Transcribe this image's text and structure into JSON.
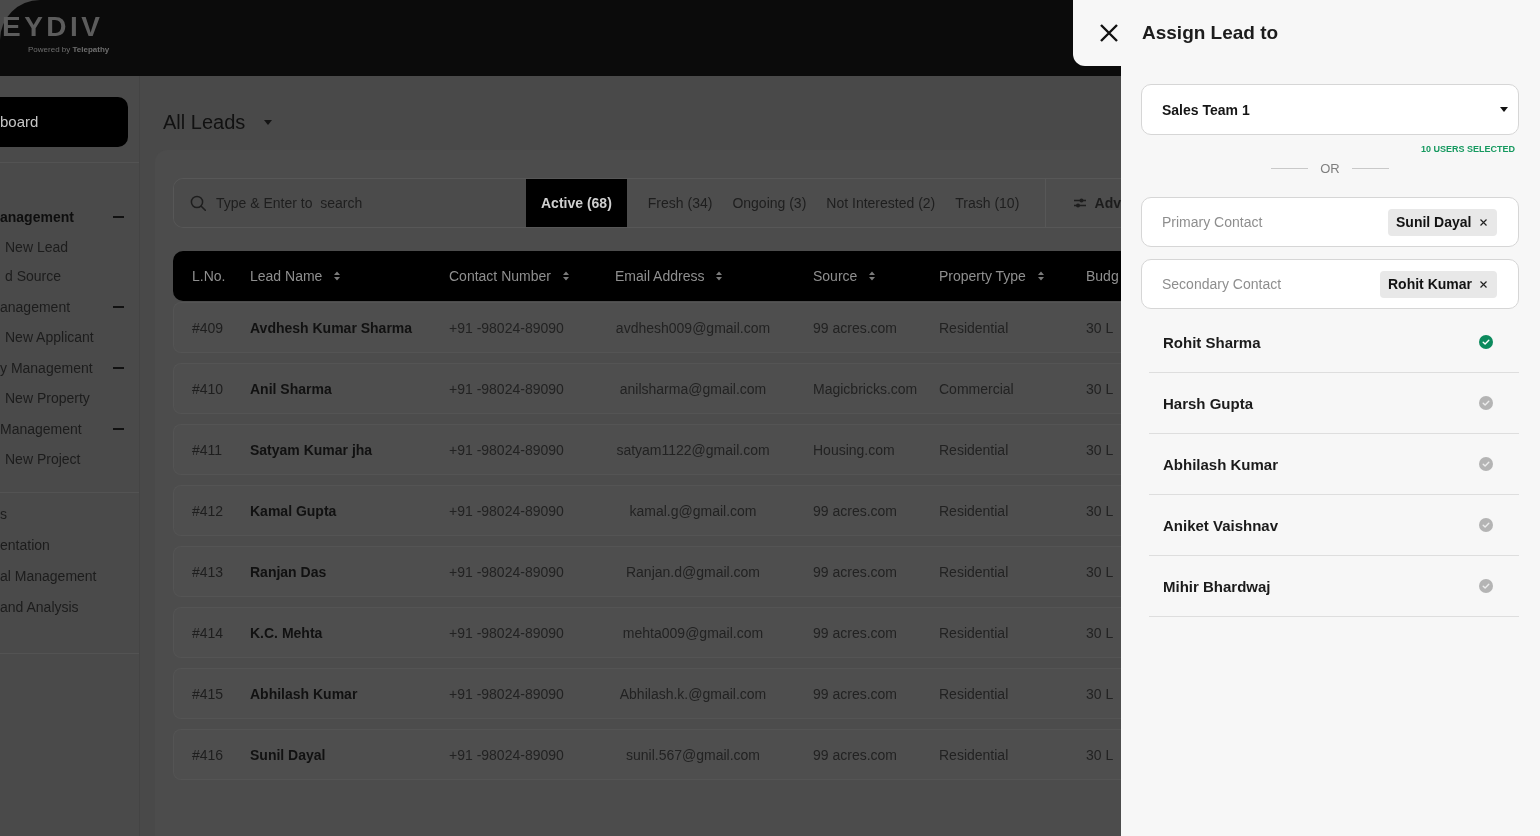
{
  "topbar": {
    "logo": "EYDIV",
    "tagline": "Powered by **Telepathy**"
  },
  "sidebar": {
    "sections": [
      {
        "items": [
          {
            "kind": "link",
            "label": "board",
            "selected": true
          }
        ]
      },
      {
        "items": [
          {
            "kind": "group",
            "label": "anagement",
            "selected": true,
            "expanded": true,
            "children": [
              {
                "label": "New Lead",
                "selected": false
              },
              {
                "label": "d Source",
                "selected": false
              }
            ]
          },
          {
            "kind": "group",
            "label": "anagement",
            "selected": false,
            "expanded": true,
            "children": [
              {
                "label": "New Applicant",
                "selected": false
              }
            ]
          },
          {
            "kind": "group",
            "label": "y Management",
            "selected": false,
            "expanded": true,
            "children": [
              {
                "label": "New Property",
                "selected": false
              }
            ]
          },
          {
            "kind": "group",
            "label": "Management",
            "selected": false,
            "expanded": true,
            "children": [
              {
                "label": "New Project",
                "selected": false
              }
            ]
          }
        ]
      },
      {
        "items": [
          {
            "kind": "link",
            "label": "s",
            "selected": false
          },
          {
            "kind": "link",
            "label": "entation",
            "selected": false
          },
          {
            "kind": "link",
            "label": "al Management",
            "selected": false
          },
          {
            "kind": "link",
            "label": "and Analysis",
            "selected": false
          }
        ]
      }
    ]
  },
  "main": {
    "title": "All Leads",
    "filter_bar": {
      "search": {
        "placeholder": "Type & Enter to  search"
      },
      "tabs": [
        {
          "label": "Active (68)",
          "selected": true
        },
        {
          "label": "Fresh (34)",
          "selected": false
        },
        {
          "label": "Ongoing (3)",
          "selected": false
        },
        {
          "label": "Not Interested (2)",
          "selected": false
        },
        {
          "label": "Trash (10)",
          "selected": false
        }
      ],
      "advanced_button": "Adv"
    },
    "table": {
      "columns": [
        {
          "label": "L.No.",
          "sortable": false
        },
        {
          "label": "Lead Name",
          "sortable": true
        },
        {
          "label": "Contact Number",
          "sortable": true
        },
        {
          "label": "Email Address",
          "sortable": true
        },
        {
          "label": "Source",
          "sortable": true
        },
        {
          "label": "Property Type",
          "sortable": true
        },
        {
          "label": "Budg",
          "sortable": false
        }
      ],
      "rows": [
        {
          "cells": [
            "#409",
            "Avdhesh Kumar Sharma",
            "+91 -98024-89090",
            "avdhesh009@gmail.com",
            "99 acres.com",
            "Residential",
            "30 L"
          ]
        },
        {
          "cells": [
            "#410",
            "Anil Sharma",
            "+91 -98024-89090",
            "anilsharma@gmail.com",
            "Magicbricks.com",
            "Commercial",
            "30 L"
          ]
        },
        {
          "cells": [
            "#411",
            "Satyam Kumar jha",
            "+91 -98024-89090",
            "satyam1122@gmail.com",
            "Housing.com",
            "Residential",
            "30 L"
          ]
        },
        {
          "cells": [
            "#412",
            "Kamal Gupta",
            "+91 -98024-89090",
            "kamal.g@gmail.com",
            "99 acres.com",
            "Residential",
            "30 L"
          ]
        },
        {
          "cells": [
            "#413",
            "Ranjan Das",
            "+91 -98024-89090",
            "Ranjan.d@gmail.com",
            "99 acres.com",
            "Residential",
            "30 L"
          ]
        },
        {
          "cells": [
            "#414",
            "K.C. Mehta",
            "+91 -98024-89090",
            "mehta009@gmail.com",
            "99 acres.com",
            "Residential",
            "30 L"
          ]
        },
        {
          "cells": [
            "#415",
            "Abhilash Kumar",
            "+91 -98024-89090",
            "Abhilash.k.@gmail.com",
            "99 acres.com",
            "Residential",
            "30 L"
          ]
        },
        {
          "cells": [
            "#416",
            "Sunil Dayal",
            "+91 -98024-89090",
            "sunil.567@gmail.com",
            "99 acres.com",
            "Residential",
            "30 L"
          ]
        }
      ]
    }
  },
  "drawer": {
    "title": "Assign Lead to",
    "team_select": {
      "value": "Sales Team 1"
    },
    "selection_note": "10 USERS SELECTED",
    "divider_label": "OR",
    "contacts": [
      {
        "placeholder": "Primary Contact",
        "chip": "Sunil Dayal"
      },
      {
        "placeholder": "Secondary Contact",
        "chip": "Rohit Kumar"
      }
    ],
    "users": [
      {
        "name": "Rohit Sharma",
        "selected": true
      },
      {
        "name": "Harsh Gupta",
        "selected": false
      },
      {
        "name": "Abhilash Kumar",
        "selected": false
      },
      {
        "name": "Aniket Vaishnav",
        "selected": false
      },
      {
        "name": "Mihir Bhardwaj",
        "selected": false
      }
    ]
  }
}
